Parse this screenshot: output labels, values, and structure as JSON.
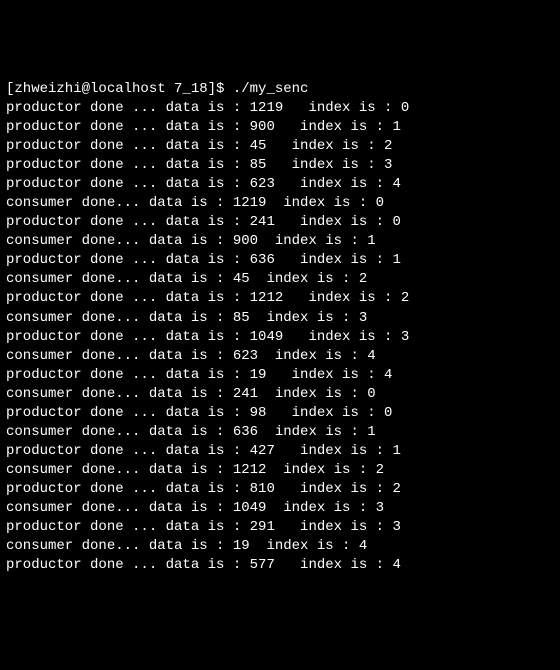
{
  "prompt": {
    "text": "[zhweizhi@localhost 7_18]$ ",
    "command": "./my_senc"
  },
  "labels": {
    "productor_prefix": "productor done ... data is : ",
    "consumer_prefix": "consumer done... data is : ",
    "index_sep_wide": "   index is : ",
    "index_sep_med": "  index is : "
  },
  "lines": [
    {
      "type": "productor",
      "data": 1219,
      "index": 0,
      "pad": "wide"
    },
    {
      "type": "productor",
      "data": 900,
      "index": 1,
      "pad": "wide"
    },
    {
      "type": "productor",
      "data": 45,
      "index": 2,
      "pad": "wide"
    },
    {
      "type": "productor",
      "data": 85,
      "index": 3,
      "pad": "wide"
    },
    {
      "type": "productor",
      "data": 623,
      "index": 4,
      "pad": "wide"
    },
    {
      "type": "consumer",
      "data": 1219,
      "index": 0,
      "pad": "med"
    },
    {
      "type": "productor",
      "data": 241,
      "index": 0,
      "pad": "wide"
    },
    {
      "type": "consumer",
      "data": 900,
      "index": 1,
      "pad": "med"
    },
    {
      "type": "productor",
      "data": 636,
      "index": 1,
      "pad": "wide"
    },
    {
      "type": "consumer",
      "data": 45,
      "index": 2,
      "pad": "med"
    },
    {
      "type": "productor",
      "data": 1212,
      "index": 2,
      "pad": "wide"
    },
    {
      "type": "consumer",
      "data": 85,
      "index": 3,
      "pad": "med"
    },
    {
      "type": "productor",
      "data": 1049,
      "index": 3,
      "pad": "wide"
    },
    {
      "type": "consumer",
      "data": 623,
      "index": 4,
      "pad": "med"
    },
    {
      "type": "productor",
      "data": 19,
      "index": 4,
      "pad": "wide"
    },
    {
      "type": "consumer",
      "data": 241,
      "index": 0,
      "pad": "med"
    },
    {
      "type": "productor",
      "data": 98,
      "index": 0,
      "pad": "wide"
    },
    {
      "type": "consumer",
      "data": 636,
      "index": 1,
      "pad": "med"
    },
    {
      "type": "productor",
      "data": 427,
      "index": 1,
      "pad": "wide"
    },
    {
      "type": "consumer",
      "data": 1212,
      "index": 2,
      "pad": "med"
    },
    {
      "type": "productor",
      "data": 810,
      "index": 2,
      "pad": "wide"
    },
    {
      "type": "consumer",
      "data": 1049,
      "index": 3,
      "pad": "med"
    },
    {
      "type": "productor",
      "data": 291,
      "index": 3,
      "pad": "wide"
    },
    {
      "type": "consumer",
      "data": 19,
      "index": 4,
      "pad": "med"
    },
    {
      "type": "productor",
      "data": 577,
      "index": 4,
      "pad": "wide"
    }
  ]
}
